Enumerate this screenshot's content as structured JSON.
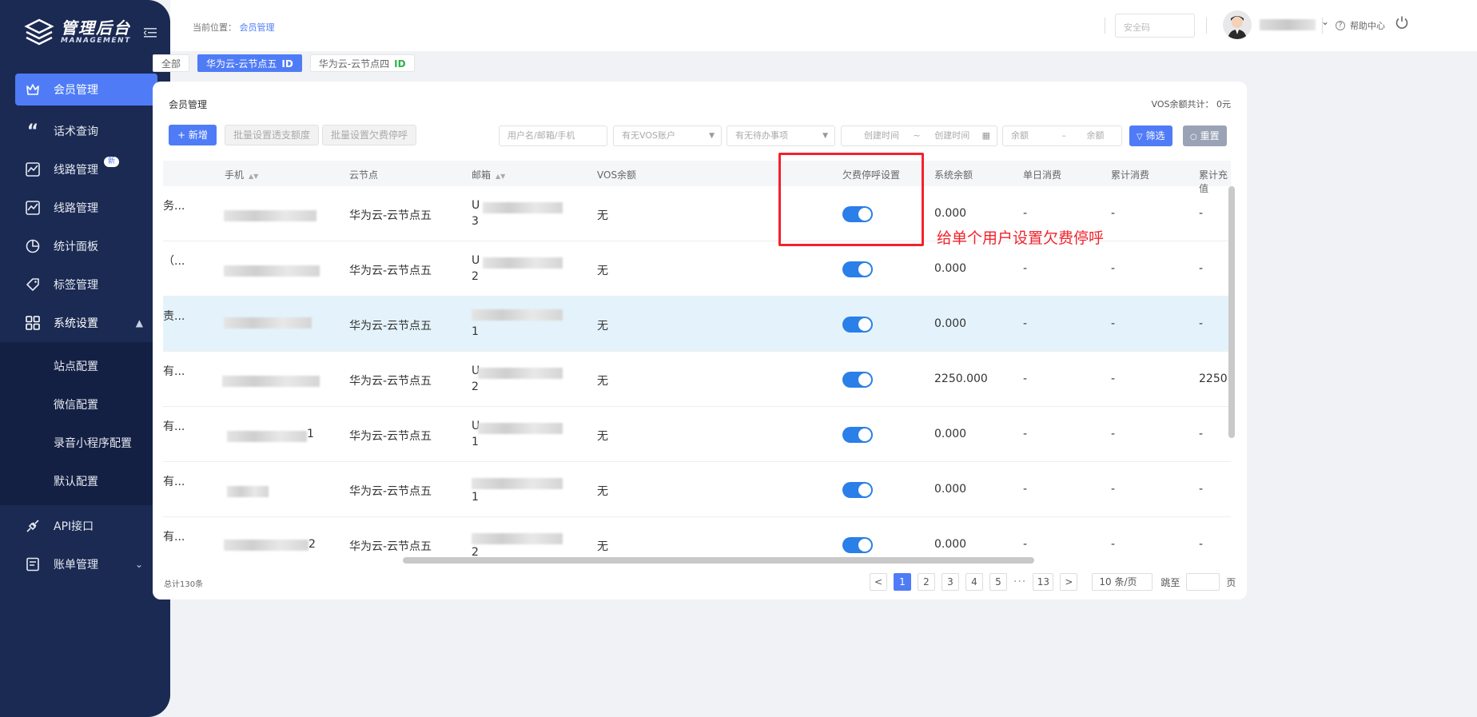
{
  "app": {
    "title": "管理后台",
    "subtitle": "MANAGEMENT"
  },
  "sidebar": {
    "items": [
      {
        "label": "会员管理",
        "icon": "crown-icon",
        "active": true
      },
      {
        "label": "话术查询",
        "icon": "quote-icon"
      },
      {
        "label": "线路管理",
        "icon": "chart-icon",
        "badge": "新"
      },
      {
        "label": "线路管理",
        "icon": "chart-icon"
      },
      {
        "label": "统计面板",
        "icon": "pie-icon"
      },
      {
        "label": "标签管理",
        "icon": "tag-icon"
      },
      {
        "label": "系统设置",
        "icon": "grid-icon",
        "expanded": true
      }
    ],
    "submenu": [
      "站点配置",
      "微信配置",
      "录音小程序配置",
      "默认配置"
    ],
    "bottom_items": [
      {
        "label": "API接口",
        "icon": "api-icon"
      },
      {
        "label": "账单管理",
        "icon": "bill-icon"
      }
    ]
  },
  "header": {
    "breadcrumb_prefix": "当前位置：",
    "breadcrumb_current": "会员管理",
    "security_placeholder": "安全码",
    "help_label": "帮助中心"
  },
  "tabs": [
    {
      "label": "全部"
    },
    {
      "label": "华为云-云节点五",
      "id_tag": "ID",
      "active": true
    },
    {
      "label": "华为云-云节点四",
      "id_tag": "ID"
    }
  ],
  "panel": {
    "title": "会员管理",
    "vos_total": "VOS余额共计：  0元",
    "add_button": "+ 新增",
    "batch_overdraft": "批量设置透支额度",
    "batch_stop": "批量设置欠费停呼",
    "filters": {
      "user_search": "用户名/邮箱/手机",
      "vos_account": "有无VOS账户",
      "pending": "有无待办事项",
      "created_start": "创建时间",
      "date_sep": "~",
      "created_end": "创建时间",
      "balance_min": "余额",
      "balance_sep": "–",
      "balance_max": "余额"
    },
    "filter_button": "筛选",
    "reset_button": "重置"
  },
  "table": {
    "columns": [
      "手机",
      "云节点",
      "邮箱",
      "VOS余额",
      "欠费停呼设置",
      "系统余额",
      "单日消费",
      "累计消费",
      "累计充值"
    ],
    "rows": [
      {
        "first": "务...",
        "phone_tail": "",
        "node": "华为云-云节点五",
        "email_head": "U",
        "email_tail": "3",
        "vos": "无",
        "balance": "0.000",
        "daily": "-",
        "total_spend": "-",
        "total_recharge": "-"
      },
      {
        "first": "（...",
        "phone_tail": "",
        "node": "华为云-云节点五",
        "email_head": "U",
        "email_tail": "2",
        "vos": "无",
        "balance": "0.000",
        "daily": "-",
        "total_spend": "-",
        "total_recharge": "-"
      },
      {
        "first": "责...",
        "phone_tail": "",
        "node": "华为云-云节点五",
        "email_head": "",
        "email_tail": "1",
        "vos": "无",
        "balance": "0.000",
        "daily": "-",
        "total_spend": "-",
        "total_recharge": "-"
      },
      {
        "first": "有...",
        "phone_tail": "",
        "node": "华为云-云节点五",
        "email_head": "U",
        "email_tail": "2",
        "vos": "无",
        "balance": "2250.000",
        "daily": "-",
        "total_spend": "-",
        "total_recharge": "2250.0"
      },
      {
        "first": "有...",
        "phone_tail": "1",
        "node": "华为云-云节点五",
        "email_head": "U",
        "email_tail": "1",
        "vos": "无",
        "balance": "0.000",
        "daily": "-",
        "total_spend": "-",
        "total_recharge": "-"
      },
      {
        "first": "有...",
        "phone_tail": "",
        "node": "华为云-云节点五",
        "email_head": "",
        "email_tail": "1",
        "vos": "无",
        "balance": "0.000",
        "daily": "-",
        "total_spend": "-",
        "total_recharge": "-"
      },
      {
        "first": "有...",
        "phone_tail": "2",
        "node": "华为云-云节点五",
        "email_head": "",
        "email_tail": "2",
        "vos": "无",
        "balance": "0.000",
        "daily": "-",
        "total_spend": "-",
        "total_recharge": "-"
      }
    ]
  },
  "pagination": {
    "total": "总计130条",
    "prev": "<",
    "pages": [
      "1",
      "2",
      "3",
      "4",
      "5"
    ],
    "ellipsis": "···",
    "last": "13",
    "next": ">",
    "page_size": "10 条/页",
    "jump_label": "跳至",
    "page_suffix": "页"
  },
  "annotation": {
    "text": "给单个用户设置欠费停呼",
    "color": "#f2222c"
  },
  "colors": {
    "primary": "#4f7cf6",
    "sidebar": "#1b2a52",
    "switch_on": "#2a7fe8",
    "highlight_row": "#e4f3fb"
  }
}
